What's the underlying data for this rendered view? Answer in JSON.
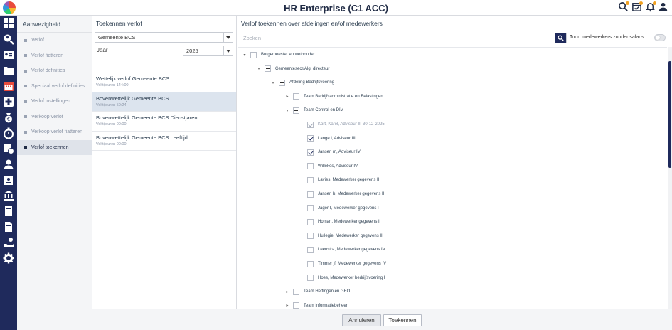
{
  "app": {
    "title": "HR Enterprise (C1 ACC)"
  },
  "menu": {
    "header": "Aanwezigheid",
    "items": [
      {
        "label": "Verlof"
      },
      {
        "label": "Verlof fiatteren"
      },
      {
        "label": "Verlof definities"
      },
      {
        "label": "Speciaal verlof definities"
      },
      {
        "label": "Verlof instellingen"
      },
      {
        "label": "Verkoop verlof"
      },
      {
        "label": "Verkoop verlof fiatteren"
      },
      {
        "label": "Verlof toekennen"
      }
    ],
    "active_index": 7
  },
  "verlof": {
    "header": "Toekennen verlof",
    "regeling_value": "Gemeente BCS",
    "periode_label": "Jaar",
    "jaar_value": "2025",
    "items": [
      {
        "name": "Wettelijk verlof Gemeente BCS",
        "sub": "Volttijduren 144:00"
      },
      {
        "name": "Bovenwettelijk Gemeente BCS",
        "sub": "Volttijduren 50:24"
      },
      {
        "name": "Bovenwettelijk Gemeente BCS Dienstjaren",
        "sub": "Volttijduren 00:00"
      },
      {
        "name": "Bovenwettelijk Gemeente BCS Leeftijd",
        "sub": "Volttijduren 00:00"
      }
    ],
    "active_index": 1
  },
  "toekennen": {
    "header": "Verlof toekennen over afdelingen en/of medewerkers",
    "search_placeholder": "Zoeken",
    "toggle_label": "Toon medewerkers zonder salaris",
    "tree": [
      {
        "label": "Burgemeester en wethouder",
        "level": 0,
        "arrow": "open",
        "check": "minus"
      },
      {
        "label": "Gemeentesecr/Alg. directeur",
        "level": 1,
        "arrow": "open",
        "check": "minus"
      },
      {
        "label": "Afdeling Bedrijfsvoering",
        "level": 2,
        "arrow": "open",
        "check": "minus"
      },
      {
        "label": "Team Bedrijfsadministratie en Belastingen",
        "level": 3,
        "arrow": "closed",
        "check": "none"
      },
      {
        "label": "Team Control en DIV",
        "level": 3,
        "arrow": "open",
        "check": "minus"
      },
      {
        "label": "Kort, Karel, Adviseur III 30-12-2025",
        "level": 4,
        "arrow": "",
        "check": "checked-dim"
      },
      {
        "label": "Lange l, Adviseur III",
        "level": 4,
        "arrow": "",
        "check": "checked"
      },
      {
        "label": "Jansen m, Adviseur IV",
        "level": 4,
        "arrow": "",
        "check": "checked"
      },
      {
        "label": "Willekes, Adviseur IV",
        "level": 4,
        "arrow": "",
        "check": "none"
      },
      {
        "label": "Lavies, Medewerker gegevens II",
        "level": 4,
        "arrow": "",
        "check": "none"
      },
      {
        "label": "Jansen b, Medewerker gegevens II",
        "level": 4,
        "arrow": "",
        "check": "none"
      },
      {
        "label": "Jager I, Medewerker gegevens I",
        "level": 4,
        "arrow": "",
        "check": "none"
      },
      {
        "label": "Homan, Medewerker gegevens I",
        "level": 4,
        "arrow": "",
        "check": "none"
      },
      {
        "label": "Hullegie, Medewerker gegevens III",
        "level": 4,
        "arrow": "",
        "check": "none"
      },
      {
        "label": "Leenstra, Medewerker gegevens IV",
        "level": 4,
        "arrow": "",
        "check": "none"
      },
      {
        "label": "Timmer jf, Medewerker gegevens IV",
        "level": 4,
        "arrow": "",
        "check": "none"
      },
      {
        "label": "Hoes, Medewerker bedrijfsvoering I",
        "level": 4,
        "arrow": "",
        "check": "none"
      },
      {
        "label": "Team Heffingen en GEO",
        "level": 3,
        "arrow": "closed",
        "check": "none"
      },
      {
        "label": "Team Informatiebeheer",
        "level": 3,
        "arrow": "closed",
        "check": "none"
      }
    ]
  },
  "footer": {
    "cancel_label": "Annuleren",
    "ok_label": "Toekennen"
  },
  "icons": {
    "sidebar": [
      "dashboard-icon",
      "search-person-icon",
      "id-card-icon",
      "folder-icon",
      "calendar-icon",
      "medical-cross-icon",
      "money-bag-icon",
      "stopwatch-icon",
      "calendar-clock-icon",
      "user-icon",
      "badge-icon",
      "bank-icon",
      "document-icon",
      "document-lines-icon",
      "hand-money-icon",
      "gear-icon"
    ],
    "top": [
      "search-person-icon",
      "calendar-check-icon",
      "bell-icon",
      "user-settings-icon"
    ]
  },
  "colors": {
    "sidebar_bg": "#1f2a5c",
    "accent": "#1f2a5c",
    "calendar_red": "#e94b3c",
    "notification": "#f0a020"
  }
}
